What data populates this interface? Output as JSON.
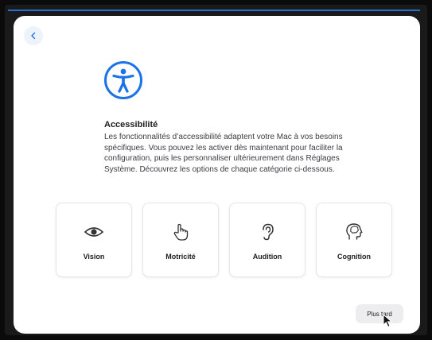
{
  "window": {
    "back_icon": "chevron-left-icon",
    "hero_icon": "accessibility-icon",
    "accent_color": "#1a73e8"
  },
  "content": {
    "title": "Accessibilité",
    "description": "Les fonctionnalités d’accessibilité adaptent votre Mac à vos besoins spécifiques. Vous pouvez les activer dès maintenant pour faciliter la configuration, puis les personnaliser ultérieurement dans Réglages Système. Découvrez les options de chaque catégorie ci-dessous."
  },
  "categories": [
    {
      "label": "Vision",
      "icon": "eye-icon"
    },
    {
      "label": "Motricité",
      "icon": "hand-pointer-icon"
    },
    {
      "label": "Audition",
      "icon": "ear-icon"
    },
    {
      "label": "Cognition",
      "icon": "head-brain-icon"
    }
  ],
  "footer": {
    "later_label": "Plus tard"
  }
}
